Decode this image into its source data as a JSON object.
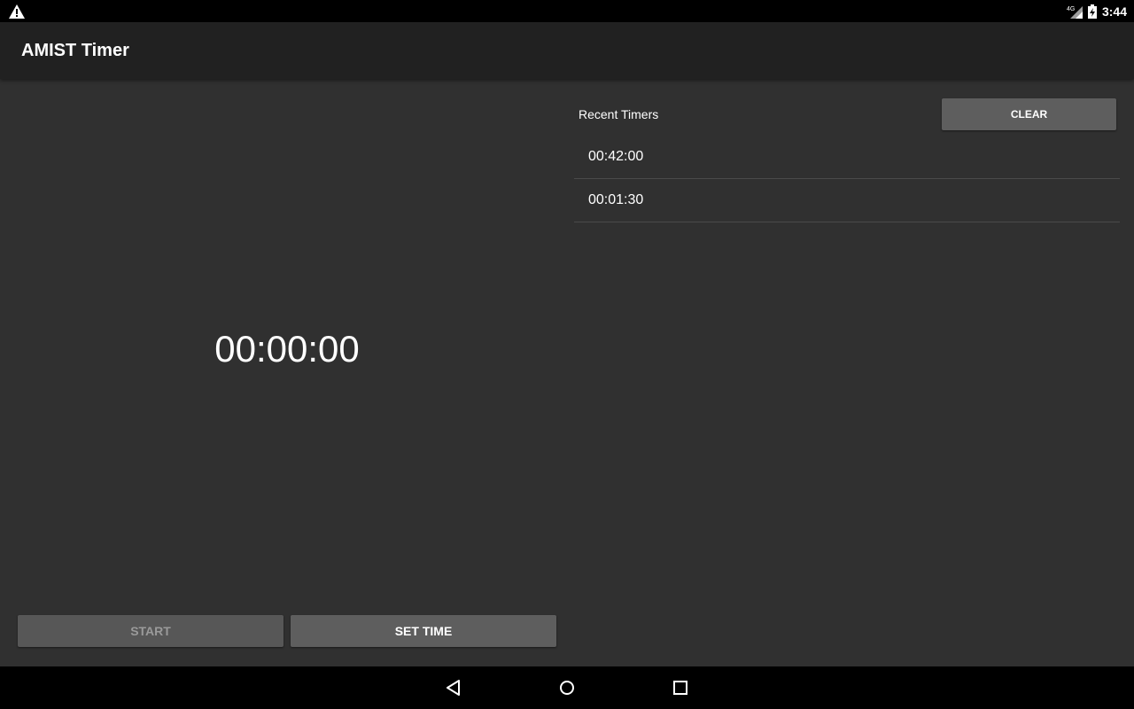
{
  "status_bar": {
    "time": "3:44",
    "network": "4G",
    "icons": [
      "warning-icon",
      "signal-icon",
      "battery-charging-icon"
    ]
  },
  "app_bar": {
    "title": "AMIST Timer"
  },
  "timer": {
    "display": "00:00:00",
    "start_label": "START",
    "set_time_label": "SET TIME"
  },
  "recent": {
    "title": "Recent Timers",
    "clear_label": "CLEAR",
    "items": [
      "00:42:00",
      "00:01:30"
    ]
  },
  "nav_bar": {
    "icons": [
      "back-icon",
      "home-icon",
      "recents-icon"
    ]
  },
  "colors": {
    "background": "#303030",
    "app_bar": "#212121",
    "button": "#5e5e5e",
    "system_bar": "#000000"
  }
}
